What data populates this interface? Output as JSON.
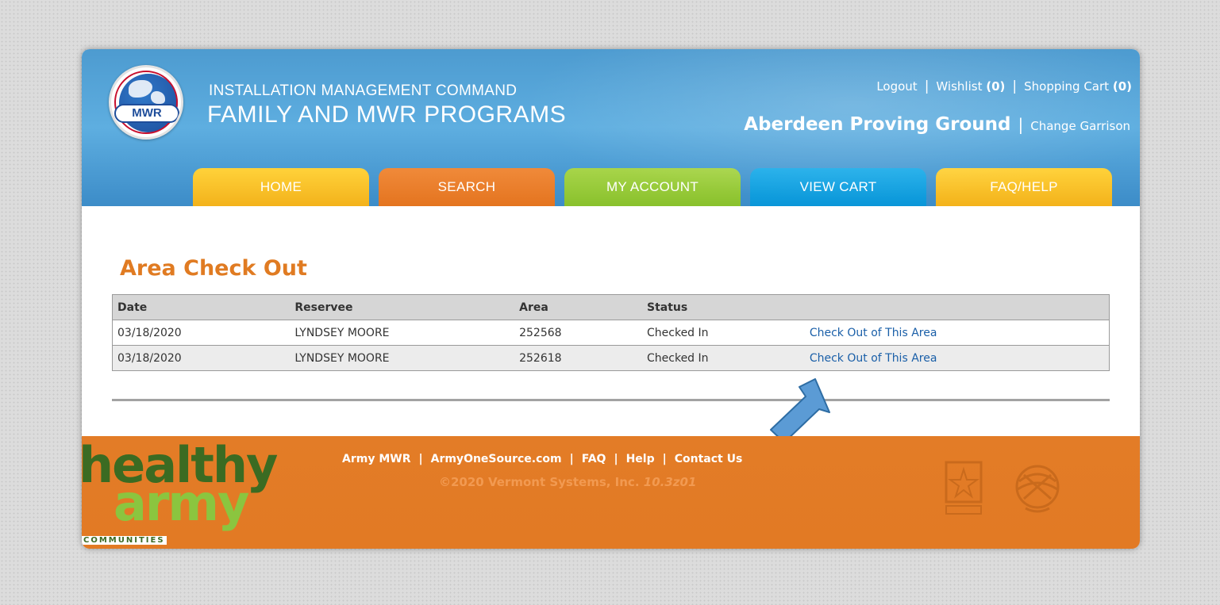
{
  "header": {
    "logo_text": "MWR",
    "org_line1": "INSTALLATION MANAGEMENT COMMAND",
    "org_line2": "FAMILY AND MWR PROGRAMS",
    "links": {
      "logout": "Logout",
      "wishlist": "Wishlist",
      "wishlist_count": "(0)",
      "cart": "Shopping Cart",
      "cart_count": "(0)"
    },
    "garrison": "Aberdeen Proving Ground",
    "change_garrison": "Change Garrison"
  },
  "nav": {
    "tabs": [
      "HOME",
      "SEARCH",
      "MY ACCOUNT",
      "VIEW CART",
      "FAQ/HELP"
    ]
  },
  "main": {
    "title": "Area Check Out",
    "columns": [
      "Date",
      "Reserveе",
      "Area",
      "Status",
      ""
    ],
    "rows": [
      {
        "date": "03/18/2020",
        "reservee": "LYNDSEY MOORE",
        "area": "252568",
        "status": "Checked In",
        "action": "Check Out of This Area"
      },
      {
        "date": "03/18/2020",
        "reservee": "LYNDSEY MOORE",
        "area": "252618",
        "status": "Checked In",
        "action": "Check Out of This Area"
      }
    ]
  },
  "footer": {
    "logo": {
      "word1": "healthy",
      "word2": "army",
      "word3": "COMMUNITIES"
    },
    "links": [
      "Army MWR",
      "ArmyOneSource.com",
      "FAQ",
      "Help",
      "Contact Us"
    ],
    "copyright": "©2020 Vermont Systems, Inc.",
    "version": "10.3z01"
  },
  "colors": {
    "header_blue": "#4d9bd0",
    "title_orange": "#e07b22",
    "footer_orange": "#e37c27",
    "link_blue": "#1a5fa8",
    "arrow_blue": "#5b9bd5"
  }
}
